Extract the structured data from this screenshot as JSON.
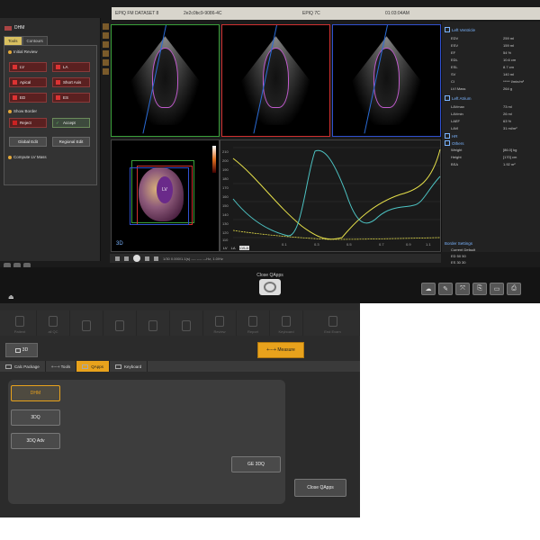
{
  "titlebar": {
    "dataset": "EPIQ FM DATASET 8",
    "id": "2e2c0bc9-9086-4C",
    "system": "EPIQ 7C",
    "time": "01:03:04AM"
  },
  "toolpanel": {
    "app_title": "DHM",
    "tabs": [
      "Tools",
      "Contours"
    ],
    "initial_review": "Initial Review",
    "view_buttons": [
      "LV",
      "LA",
      "Apical",
      "Short Axis",
      "ED",
      "ES"
    ],
    "show_border": "Show Border",
    "reject": "Reject",
    "accept": "Accept",
    "global_edit": "Global Edit",
    "regional_edit": "Regional Edit",
    "compute_lv_mass": "Compute LV Mass"
  },
  "view3d": {
    "label": "3D",
    "lv_tag": "LV"
  },
  "graph": {
    "y_ticks": [
      "210",
      "200",
      "190",
      "180",
      "170",
      "160",
      "150",
      "140",
      "130",
      "120",
      "110"
    ],
    "x_ticks": [
      "0.1",
      "0.3",
      "0.5",
      "0.7",
      "0.9",
      "1.1"
    ],
    "legend": [
      "LV",
      "LA",
      "LVLA"
    ]
  },
  "measurements": {
    "lv_title": "Left Ventricle",
    "lv_rows": [
      {
        "label": "EDV",
        "value": "259 ml"
      },
      {
        "label": "ESV",
        "value": "159 ml"
      },
      {
        "label": "EF",
        "value": "54 %"
      },
      {
        "label": "EDL",
        "value": "10.6 cm"
      },
      {
        "label": "ESL",
        "value": "8.7 cm"
      },
      {
        "label": "SV",
        "value": "140 ml"
      },
      {
        "label": "CI",
        "value": "***** l/min/m²"
      },
      {
        "label": "LVI Mass",
        "value": "264 g"
      }
    ],
    "la_title": "Left Atrium",
    "la_rows": [
      {
        "label": "LAVmax",
        "value": "73 ml"
      },
      {
        "label": "LAVmin",
        "value": "26 ml"
      },
      {
        "label": "LAEF",
        "value": "63 %"
      },
      {
        "label": "LAVI",
        "value": "31 ml/m²"
      }
    ],
    "hr_title": "HR",
    "others_title": "Others",
    "other_rows": [
      {
        "label": "Weight",
        "value": "[86.0] kg"
      },
      {
        "label": "Height",
        "value": "[170] cm"
      },
      {
        "label": "BSA",
        "value": "1.92 m²"
      }
    ],
    "border_settings": "Border Settings",
    "bs_header": "Current   Default",
    "bs_rows": [
      "ED   50     50",
      "ES   30     30"
    ]
  },
  "playbar": {
    "info": "1/30  0.000/1.1(s) ---- ---- ---Hz, 1.0/Hz"
  },
  "mid": {
    "close_qapps_label": "Close QApps",
    "eject": "⏏"
  },
  "sys_icons": [
    "☁",
    "✎",
    "⤧",
    "⎘",
    "▭",
    "⎙"
  ],
  "toolbar": {
    "items": [
      "Patient",
      "all QC",
      "",
      "",
      "",
      "",
      "Review",
      "Report",
      "Keyboard"
    ],
    "end_exam": "End Exam"
  },
  "buttons": {
    "three_d": "3D",
    "measure": "+---+ Measure"
  },
  "tabs": [
    "Calc Package",
    "+---+ Tools",
    "QApps",
    "Keyboard"
  ],
  "qapps": {
    "dhm": "DHM",
    "three_dq": "3DQ",
    "three_dq_adv": "3DQ Adv",
    "ge_3dq": "GE 3DQ",
    "close": "Close QApps"
  },
  "colors": {
    "accent": "#e8a21c",
    "lv_curve": "#e6e04a",
    "la_curve": "#4dc4c4"
  }
}
